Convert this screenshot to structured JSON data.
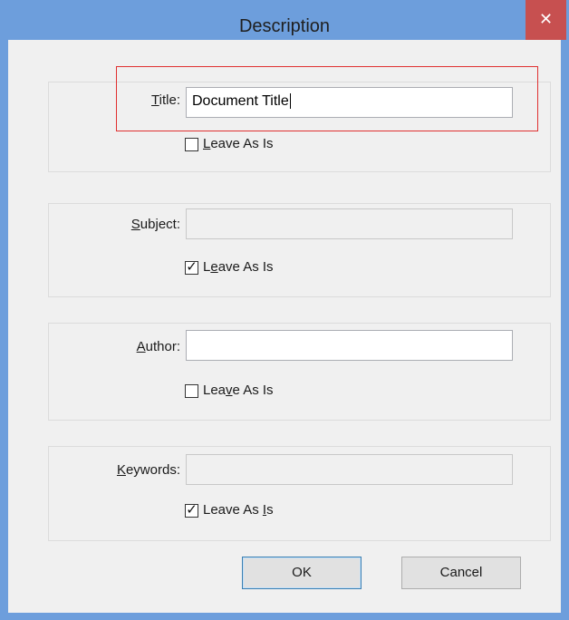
{
  "window": {
    "title": "Description",
    "close_glyph": "✕"
  },
  "fields": [
    {
      "label_pre": "",
      "label_key": "T",
      "label_post": "itle:",
      "value": "Document Title",
      "checkbox_pre": "",
      "checkbox_key": "L",
      "checkbox_post": "eave As Is",
      "checked": false,
      "enabled": true
    },
    {
      "label_pre": "",
      "label_key": "S",
      "label_post": "ubject:",
      "value": "",
      "checkbox_pre": "L",
      "checkbox_key": "e",
      "checkbox_post": "ave As Is",
      "checked": true,
      "enabled": false
    },
    {
      "label_pre": "",
      "label_key": "A",
      "label_post": "uthor:",
      "value": "",
      "checkbox_pre": "Lea",
      "checkbox_key": "v",
      "checkbox_post": "e As Is",
      "checked": false,
      "enabled": true
    },
    {
      "label_pre": "",
      "label_key": "K",
      "label_post": "eywords:",
      "value": "",
      "checkbox_pre": "Leave As ",
      "checkbox_key": "I",
      "checkbox_post": "s",
      "checked": true,
      "enabled": false
    }
  ],
  "buttons": {
    "ok": "OK",
    "cancel": "Cancel"
  },
  "checkmark_glyph": "✓",
  "colors": {
    "titlebar": "#6d9edc",
    "close": "#c75050",
    "highlight": "#e03030"
  }
}
